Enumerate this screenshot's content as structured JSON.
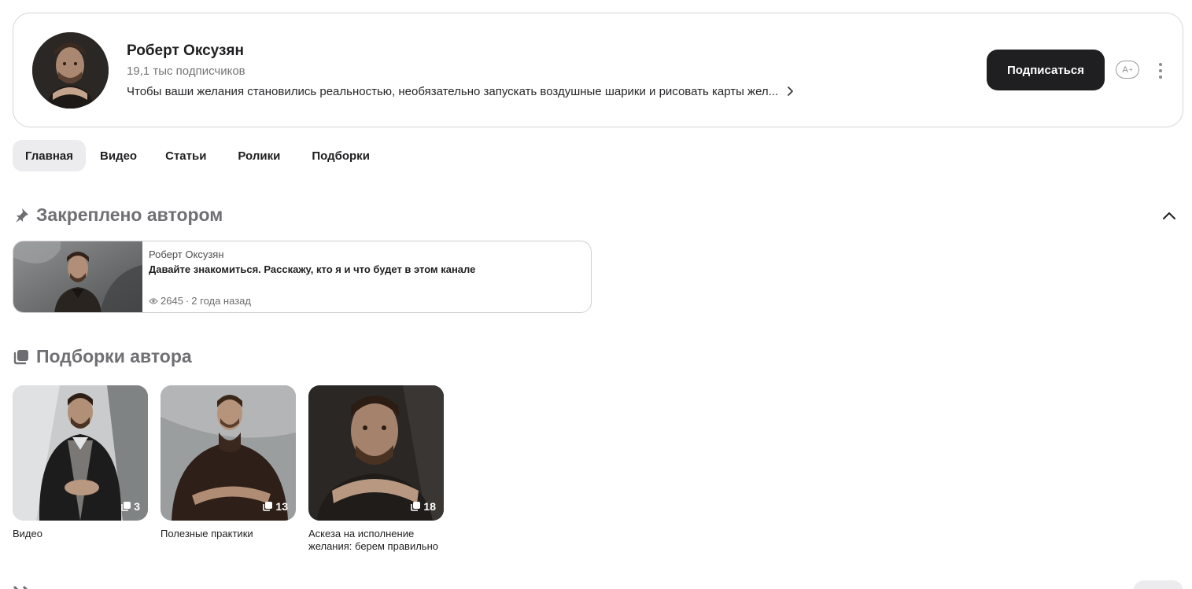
{
  "channel": {
    "name": "Роберт Оксузян",
    "subscribers": "19,1 тыс подписчиков",
    "description": "Чтобы ваши желания становились реальностью, необязательно запускать воздушные шарики и рисовать карты жел...",
    "subscribe_label": "Подписаться",
    "font_size_icon_label": "A",
    "font_size_icon_sup": "+"
  },
  "tabs": [
    {
      "label": "Главная",
      "active": true
    },
    {
      "label": "Видео",
      "active": false
    },
    {
      "label": "Статьи",
      "active": false
    },
    {
      "label": "Ролики",
      "active": false
    },
    {
      "label": "Подборки",
      "active": false
    }
  ],
  "pinned": {
    "section_title": "Закреплено автором",
    "author": "Роберт Оксузян",
    "title": "Давайте знакомиться. Расскажу, кто я и что будет в этом канале",
    "views": "2645",
    "separator": "·",
    "age": "2 года назад"
  },
  "collections": {
    "section_title": "Подборки автора",
    "items": [
      {
        "title": "Видео",
        "count": "3"
      },
      {
        "title": "Полезные практики",
        "count": "13"
      },
      {
        "title": "Аскеза на исполнение желания: берем правильно",
        "count": "18"
      }
    ]
  },
  "icons": {
    "pin": "pin-icon",
    "collections": "collections-icon",
    "collapse": "chevron-up-icon",
    "more": "more-vertical-icon",
    "eye": "eye-icon"
  }
}
